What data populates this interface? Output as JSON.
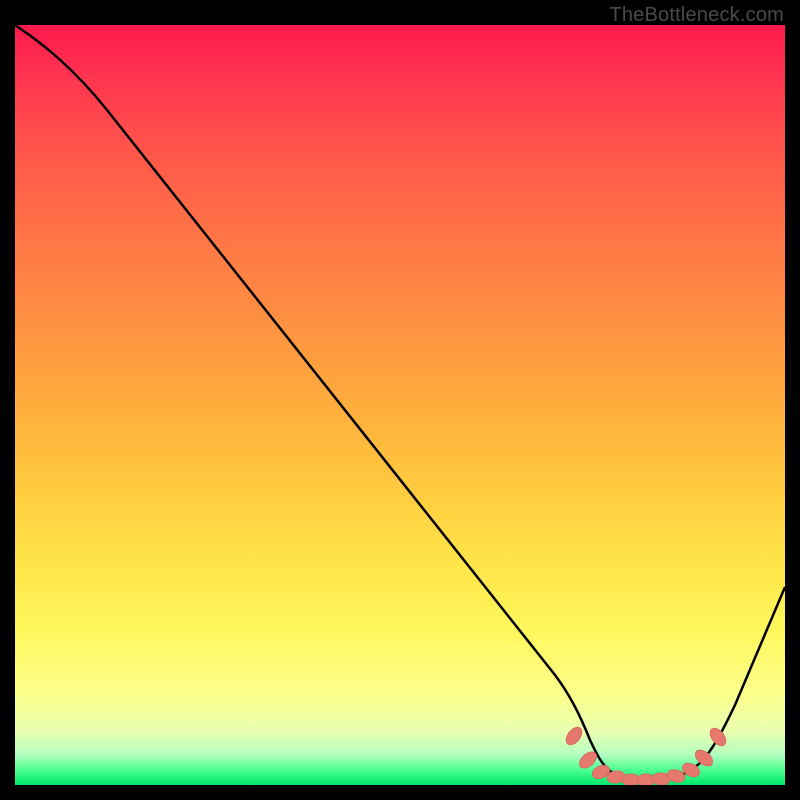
{
  "watermark": "TheBottleneck.com",
  "chart_data": {
    "type": "line",
    "title": "",
    "xlabel": "",
    "ylabel": "",
    "xlim": [
      0,
      100
    ],
    "ylim": [
      0,
      100
    ],
    "series": [
      {
        "name": "bottleneck-curve",
        "x": [
          0,
          6,
          12,
          20,
          30,
          40,
          50,
          60,
          67,
          70,
          73,
          76,
          79,
          82,
          85,
          88,
          92,
          96,
          100
        ],
        "y": [
          100,
          97,
          92,
          83,
          70,
          57,
          44,
          31,
          22,
          15,
          5,
          1,
          0,
          0,
          0,
          1,
          6,
          15,
          26
        ]
      }
    ],
    "highlight_points": {
      "name": "optimal-range",
      "x": [
        72.5,
        74.5,
        76,
        78,
        80,
        82,
        84,
        86,
        88,
        89.5,
        91.5
      ],
      "y": [
        6,
        2.5,
        1,
        0.3,
        0,
        0,
        0,
        0.5,
        1.5,
        3.5,
        6
      ]
    },
    "background_gradient": "red-yellow-green vertical (bottleneck severity)"
  }
}
